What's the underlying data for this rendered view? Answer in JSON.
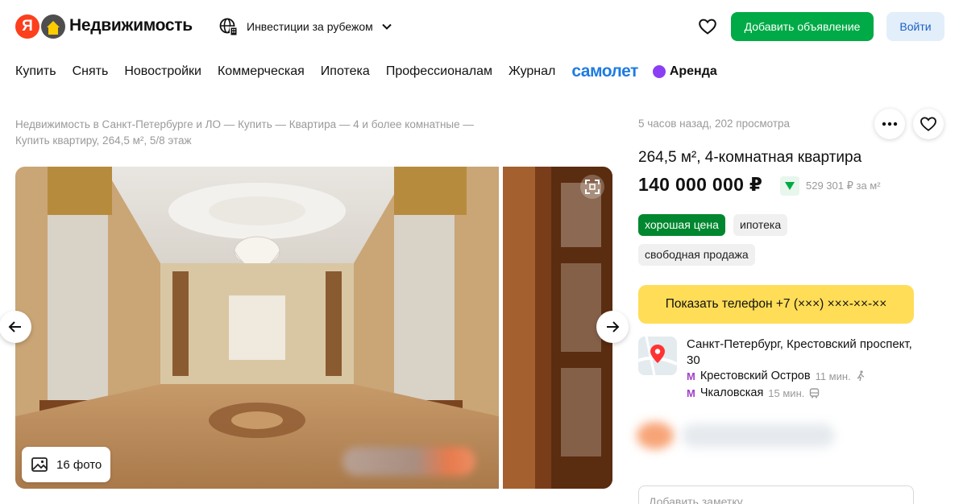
{
  "header": {
    "brand": "Недвижимость",
    "invest_label": "Инвестиции за рубежом",
    "add_button": "Добавить объявление",
    "login_button": "Войти"
  },
  "nav": {
    "items": [
      "Купить",
      "Снять",
      "Новостройки",
      "Коммерческая",
      "Ипотека",
      "Профессионалам",
      "Журнал"
    ],
    "samolet": "самолет",
    "arenda": "Аренда"
  },
  "breadcrumbs": {
    "items": [
      "Недвижимость в Санкт-Петербурге и ЛО",
      "Купить",
      "Квартира",
      "4 и более комнатные",
      "Купить квартиру, 264,5 м², 5/8 этаж"
    ],
    "separator": " — "
  },
  "gallery": {
    "photo_count": "16 фото"
  },
  "listing": {
    "meta": "5 часов назад, 202 просмотра",
    "title": "264,5 м², 4-комнатная квартира",
    "price": "140 000 000 ₽",
    "price_per_m": "529 301 ₽ за м²",
    "tags": [
      "хорошая цена",
      "ипотека",
      "свободная продажа"
    ],
    "phone_button": "Показать телефон +7 (×××) ×××-××-××",
    "address": "Санкт-Петербург, Крестовский проспект, 30",
    "metro": [
      {
        "icon": "М",
        "station": "Крестовский Остров",
        "time": "11 мин.",
        "mode": "walk-icon"
      },
      {
        "icon": "М",
        "station": "Чкаловская",
        "time": "15 мин.",
        "mode": "bus-icon"
      }
    ],
    "note_placeholder": "Добавить заметку"
  },
  "colors": {
    "green": "#00aa46",
    "good_price": "#00872f",
    "phone_yellow": "#ffdd57",
    "samolet_blue": "#1e7be2",
    "metro_purple": "#a23fc7"
  }
}
